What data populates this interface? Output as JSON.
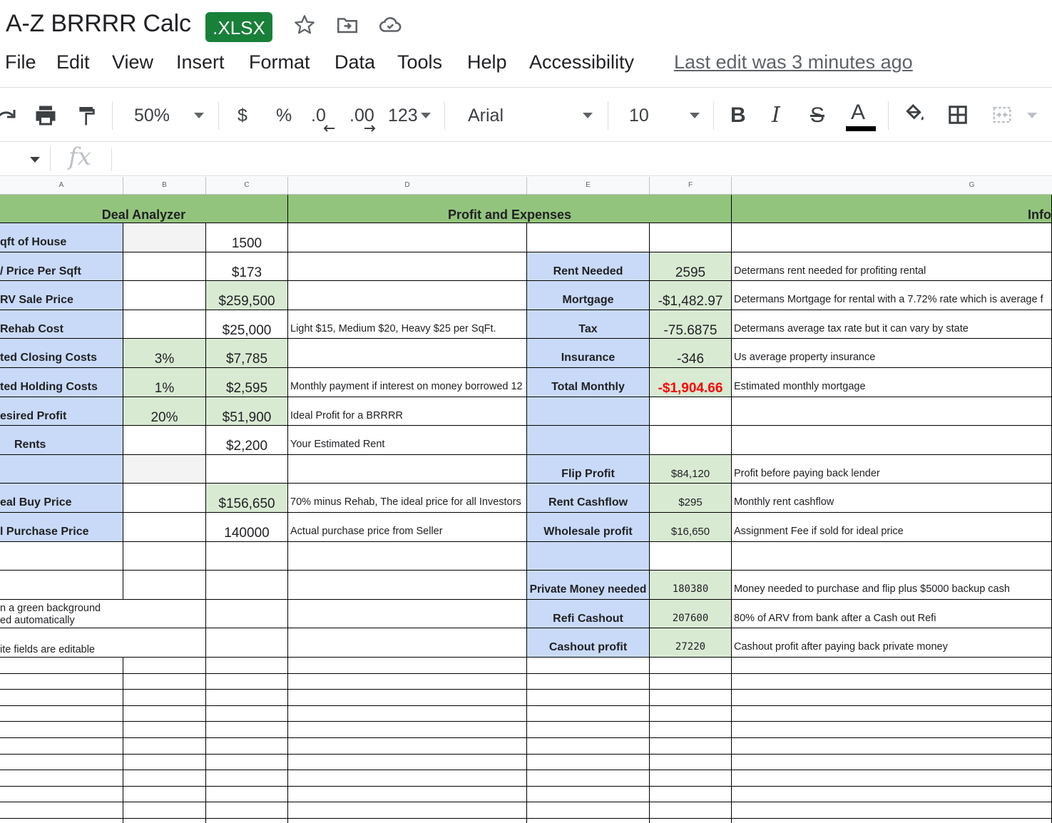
{
  "doc": {
    "title": "A-Z BRRRR Calc",
    "badge": ".XLSX"
  },
  "menu": {
    "items": [
      "File",
      "Edit",
      "View",
      "Insert",
      "Format",
      "Data",
      "Tools",
      "Help",
      "Accessibility"
    ],
    "last_edit": "Last edit was 3 minutes ago"
  },
  "toolbar": {
    "zoom": "50%",
    "currency": "$",
    "percent": "%",
    "dec_decrease": ".0",
    "dec_increase": ".00",
    "more_formats": "123",
    "font": "Arial",
    "font_size": "10",
    "bold": "B",
    "italic": "I",
    "strike": "S",
    "text_color": "A"
  },
  "colors": {
    "header_green": "#93c47d",
    "label_blue": "#c9daf8",
    "value_green": "#d9ead3",
    "badge_green": "#188038",
    "negative_red": "#ff0000"
  },
  "columns": [
    "A",
    "B",
    "C",
    "D",
    "E",
    "F",
    "G"
  ],
  "sheet": {
    "header_deal": "Deal Analyzer",
    "header_profit": "Profit and Expenses",
    "header_info": "Info",
    "rows": [
      {
        "a": "qft of House",
        "b": "",
        "c": "1500",
        "d": "",
        "e": "",
        "f": "",
        "g": ""
      },
      {
        "a": "/ Price Per Sqft",
        "b": "",
        "c": "$173",
        "d": "",
        "e": "Rent Needed",
        "f": "2595",
        "g": "Determans rent needed for profiting rental"
      },
      {
        "a": "RV Sale Price",
        "b": "",
        "c": "$259,500",
        "d": "",
        "e": "Mortgage",
        "f": "-$1,482.97",
        "g": "Determans Mortgage for rental with a 7.72% rate which is average f"
      },
      {
        "a": "Rehab Cost",
        "b": "",
        "c": "$25,000",
        "d": "Light $15, Medium $20, Heavy $25 per SqFt.",
        "e": "Tax",
        "f": "-75.6875",
        "g": "Determans average tax rate but it can vary by state"
      },
      {
        "a": "ted Closing Costs",
        "b": "3%",
        "c": "$7,785",
        "d": "",
        "e": "Insurance",
        "f": "-346",
        "g": "Us average property insurance"
      },
      {
        "a": "ted Holding Costs",
        "b": "1%",
        "c": "$2,595",
        "d": "Monthly payment if interest on money borrowed 12",
        "e": "Total Monthly",
        "f": "-$1,904.66",
        "g": "Estimated monthly mortgage"
      },
      {
        "a": "esired Profit",
        "b": "20%",
        "c": "$51,900",
        "d": "Ideal Profit for a BRRRR",
        "e": "",
        "f": "",
        "g": ""
      },
      {
        "a": "Rents",
        "b": "",
        "c": "$2,200",
        "d": "Your Estimated Rent",
        "e": "",
        "f": "",
        "g": ""
      },
      {
        "a": "",
        "b": "",
        "c": "",
        "d": "",
        "e": "Flip Profit",
        "f": "$84,120",
        "g": "Profit before paying back lender"
      },
      {
        "a": "eal Buy Price",
        "b": "",
        "c": "$156,650",
        "d": "70% minus Rehab, The ideal price for all Investors",
        "e": "Rent Cashflow",
        "f": "$295",
        "g": "Monthly rent cashflow"
      },
      {
        "a": "l Purchase Price",
        "b": "",
        "c": "140000",
        "d": "Actual purchase price from Seller",
        "e": "Wholesale profit",
        "f": "$16,650",
        "g": "Assignment Fee if sold for ideal price"
      },
      {
        "a": "",
        "b": "",
        "c": "",
        "d": "",
        "e": "",
        "f": "",
        "g": ""
      },
      {
        "a": "",
        "b": "",
        "c": "",
        "d": "",
        "e": "Private Money needed",
        "f": "180380",
        "g": "Money needed to purchase and flip plus $5000 backup cash"
      },
      {
        "a": "n a green background\ned automatically",
        "b": "",
        "c": "",
        "d": "",
        "e": "Refi Cashout",
        "f": "207600",
        "g": "80% of ARV from bank after a Cash out Refi"
      },
      {
        "a": "ite fields are editable",
        "b": "",
        "c": "",
        "d": "",
        "e": "Cashout profit",
        "f": "27220",
        "g": "Cashout profit after paying back private money"
      }
    ]
  }
}
